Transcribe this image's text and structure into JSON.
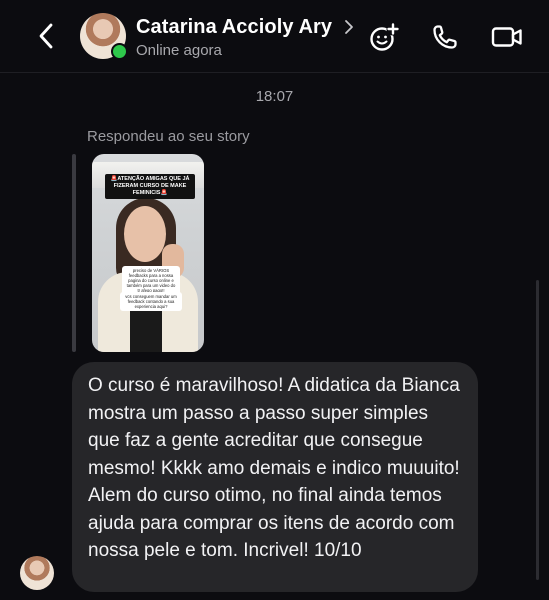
{
  "header": {
    "back_icon": "chevron-left-icon",
    "contact_name": "Catarina Accioly Ary",
    "name_chevron_icon": "chevron-right-icon",
    "status": "Online agora",
    "online": true,
    "actions": [
      {
        "icon": "add-effect-icon"
      },
      {
        "icon": "phone-icon"
      },
      {
        "icon": "video-camera-icon"
      }
    ]
  },
  "thread": {
    "timestamp": "18:07",
    "story_reply": {
      "label": "Respondeu ao seu story",
      "caption": "🚨ATENÇÃO AMIGAS QUE JÁ FIZERAM CURSO DE MAKE FEMINICIS🚨",
      "note_1": "preciso de VÁRIOS feedbacks para a nossa pagina do curso online e também para um video do tr afego pago!!",
      "note_2": "vcs conseguem mandar um feedback contando a sua experiencia aqui?"
    },
    "message": {
      "text": "O curso é maravilhoso! A didatica da Bianca mostra um passo a passo super simples que faz a gente acreditar que consegue mesmo! Kkkk amo demais e indico muuuito! Alem do curso otimo, no final ainda temos ajuda para comprar os itens de acordo com nossa pele e tom. Incrivel! 10/10"
    }
  },
  "colors": {
    "background": "#0c0c10",
    "bubble": "#262629",
    "online": "#2ec84b",
    "secondary_text": "#a8a8ad"
  }
}
